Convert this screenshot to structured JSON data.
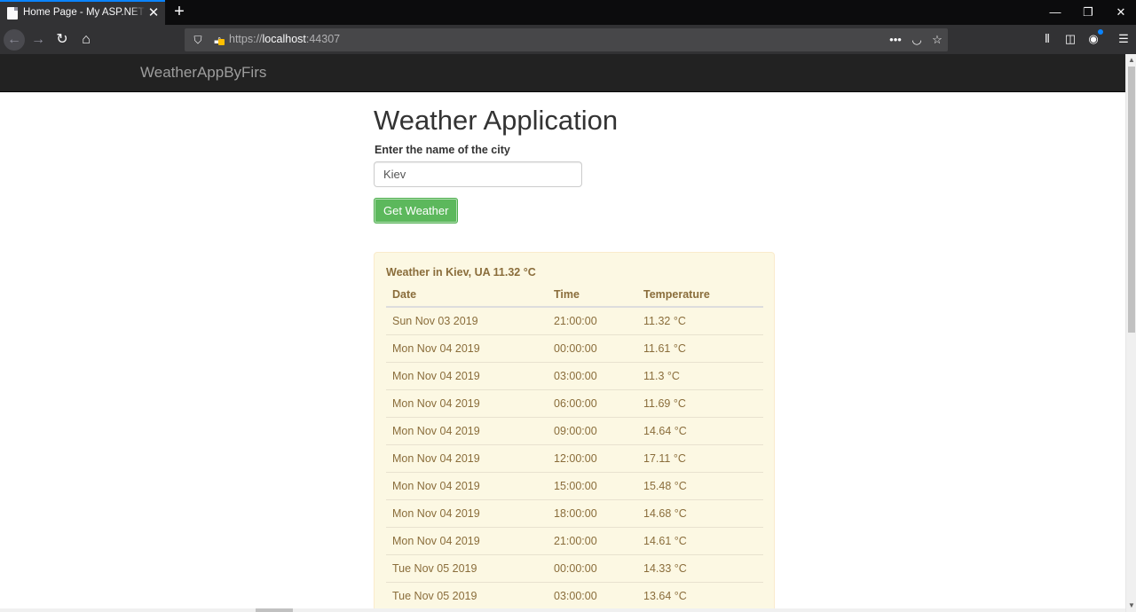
{
  "browser": {
    "tab_title": "Home Page - My ASP.NET Application",
    "close_tab_glyph": "✕",
    "new_tab_glyph": "+",
    "url_scheme": "https://",
    "url_host": "localhost",
    "url_port": ":44307",
    "window": {
      "minimize": "—",
      "restore": "❐",
      "close": "✕"
    }
  },
  "site": {
    "brand": "WeatherAppByFirs",
    "title": "Weather Application",
    "city_label": "Enter the name of the city",
    "city_value": "Kiev",
    "button_label": "Get Weather"
  },
  "weather": {
    "heading": "Weather in Kiev, UA 11.32 °C",
    "columns": [
      "Date",
      "Time",
      "Temperature"
    ],
    "rows": [
      {
        "date": "Sun Nov 03 2019",
        "time": "21:00:00",
        "temp": "11.32 °C"
      },
      {
        "date": "Mon Nov 04 2019",
        "time": "00:00:00",
        "temp": "11.61 °C"
      },
      {
        "date": "Mon Nov 04 2019",
        "time": "03:00:00",
        "temp": "11.3 °C"
      },
      {
        "date": "Mon Nov 04 2019",
        "time": "06:00:00",
        "temp": "11.69 °C"
      },
      {
        "date": "Mon Nov 04 2019",
        "time": "09:00:00",
        "temp": "14.64 °C"
      },
      {
        "date": "Mon Nov 04 2019",
        "time": "12:00:00",
        "temp": "17.11 °C"
      },
      {
        "date": "Mon Nov 04 2019",
        "time": "15:00:00",
        "temp": "15.48 °C"
      },
      {
        "date": "Mon Nov 04 2019",
        "time": "18:00:00",
        "temp": "14.68 °C"
      },
      {
        "date": "Mon Nov 04 2019",
        "time": "21:00:00",
        "temp": "14.61 °C"
      },
      {
        "date": "Tue Nov 05 2019",
        "time": "00:00:00",
        "temp": "14.33 °C"
      },
      {
        "date": "Tue Nov 05 2019",
        "time": "03:00:00",
        "temp": "13.64 °C"
      }
    ]
  },
  "colors": {
    "panel_bg": "#fcf8e3",
    "panel_text": "#8a6d3b",
    "button_green": "#5cb85c",
    "site_nav": "#222222",
    "browser_accent": "#0a84ff"
  }
}
